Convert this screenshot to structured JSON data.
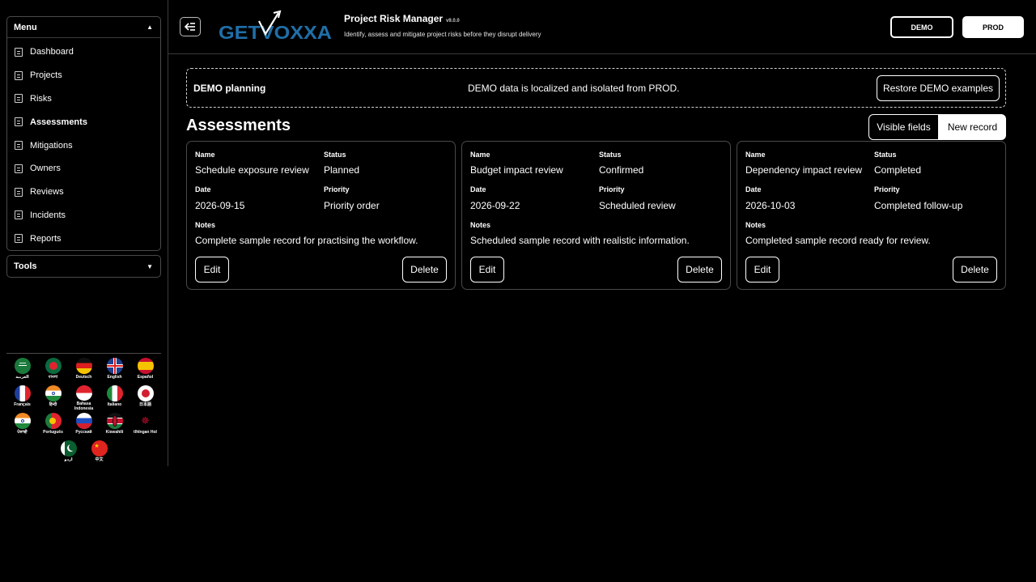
{
  "sidebar": {
    "menu_title": "Menu",
    "tools_title": "Tools",
    "items": [
      {
        "label": "Dashboard"
      },
      {
        "label": "Projects"
      },
      {
        "label": "Risks"
      },
      {
        "label": "Assessments"
      },
      {
        "label": "Mitigations"
      },
      {
        "label": "Owners"
      },
      {
        "label": "Reviews"
      },
      {
        "label": "Incidents"
      },
      {
        "label": "Reports"
      }
    ],
    "active_item": "Assessments"
  },
  "languages": [
    {
      "label": "العربية",
      "icon": "saudi-flag-icon"
    },
    {
      "label": "বাংলা",
      "icon": "bangladesh-flag-icon"
    },
    {
      "label": "Deutsch",
      "icon": "germany-flag-icon"
    },
    {
      "label": "English",
      "icon": "uk-flag-icon"
    },
    {
      "label": "Español",
      "icon": "spain-flag-icon"
    },
    {
      "label": "Français",
      "icon": "france-flag-icon"
    },
    {
      "label": "हिन्दी",
      "icon": "india-flag-icon"
    },
    {
      "label": "Bahasa Indonesia",
      "icon": "indonesia-flag-icon"
    },
    {
      "label": "Italiano",
      "icon": "italy-flag-icon"
    },
    {
      "label": "日本語",
      "icon": "japan-flag-icon"
    },
    {
      "label": "ਪੰਜਾਬੀ",
      "icon": "india-flag-icon"
    },
    {
      "label": "Português",
      "icon": "portugal-flag-icon"
    },
    {
      "label": "Русский",
      "icon": "russia-flag-icon"
    },
    {
      "label": "Kiswahili",
      "icon": "kenya-flag-icon"
    },
    {
      "label": "tlhIngan Hol",
      "icon": "klingon-emblem-icon"
    },
    {
      "label": "اردو",
      "icon": "pakistan-flag-icon"
    },
    {
      "label": "中文",
      "icon": "china-flag-icon"
    }
  ],
  "header": {
    "logo_text": "GETVOXXA",
    "title": "Project Risk Manager",
    "version": "v9.0.0",
    "subtitle": "Identify, assess and mitigate project risks before they disrupt delivery",
    "demo_label": "DEMO",
    "prod_label": "PROD"
  },
  "banner": {
    "title": "DEMO planning",
    "message": "DEMO data is localized and isolated from PROD.",
    "restore_label": "Restore DEMO examples"
  },
  "main": {
    "title": "Assessments",
    "visible_fields_label": "Visible fields",
    "new_record_label": "New record",
    "field_labels": {
      "name": "Name",
      "status": "Status",
      "date": "Date",
      "priority": "Priority",
      "notes": "Notes"
    },
    "edit_label": "Edit",
    "delete_label": "Delete",
    "records": [
      {
        "name": "Schedule exposure review",
        "status": "Planned",
        "date": "2026-09-15",
        "priority": "Priority order",
        "notes": "Complete sample record for practising the workflow."
      },
      {
        "name": "Budget impact review",
        "status": "Confirmed",
        "date": "2026-09-22",
        "priority": "Scheduled review",
        "notes": "Scheduled sample record with realistic information."
      },
      {
        "name": "Dependency impact review",
        "status": "Completed",
        "date": "2026-10-03",
        "priority": "Completed follow-up",
        "notes": "Completed sample record ready for review."
      }
    ]
  },
  "colors": {
    "background": "#000000",
    "border": "#4a4a4a",
    "text": "#ffffff",
    "logo_blue": "#1f6fa8"
  }
}
